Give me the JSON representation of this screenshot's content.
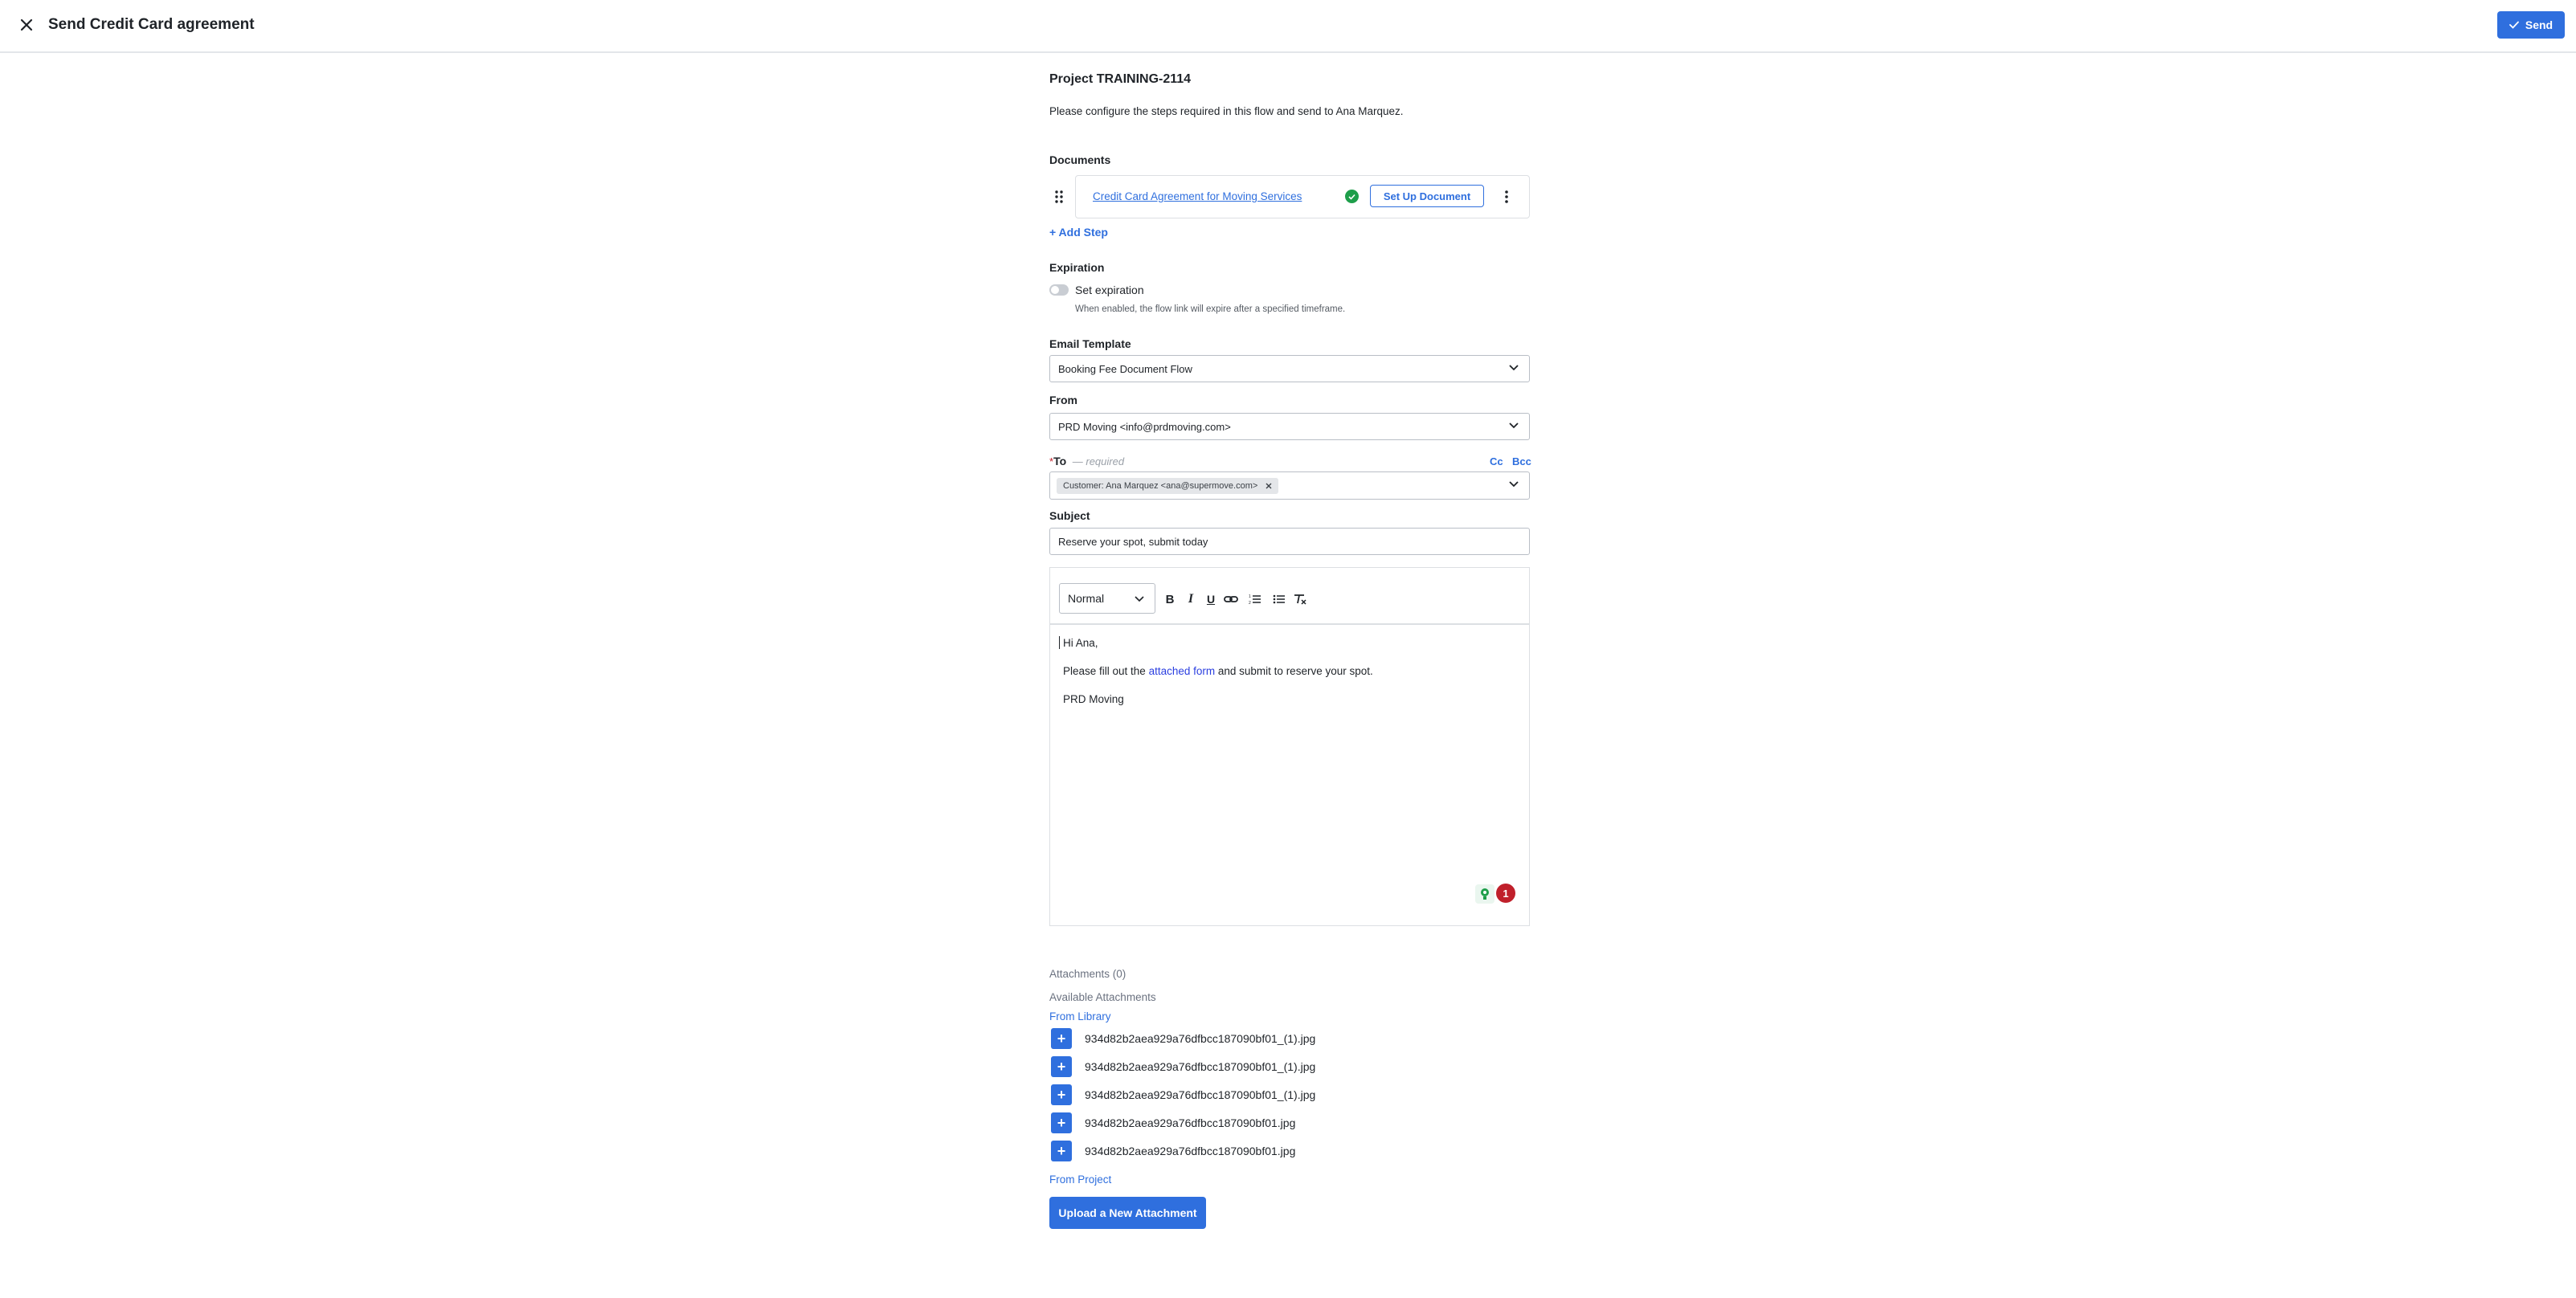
{
  "header": {
    "title": "Send Credit Card agreement",
    "send_label": "Send"
  },
  "project": {
    "title": "Project TRAINING-2114",
    "description": "Please configure the steps required in this flow and send to Ana Marquez."
  },
  "documents": {
    "heading": "Documents",
    "items": [
      {
        "name": "Credit Card Agreement for Moving Services",
        "status": "complete",
        "action_label": "Set Up Document"
      }
    ],
    "add_step_label": "+ Add Step"
  },
  "expiration": {
    "heading": "Expiration",
    "toggle_label": "Set expiration",
    "toggle_on": false,
    "help": "When enabled, the flow link will expire after a specified timeframe."
  },
  "email": {
    "template_label": "Email Template",
    "template_value": "Booking Fee Document Flow",
    "from_label": "From",
    "from_value": "PRD Moving <info@prdmoving.com>",
    "to_required_mark": "*",
    "to_label": "To",
    "to_hint": "— required",
    "cc_label": "Cc",
    "bcc_label": "Bcc",
    "to_chip": "Customer: Ana Marquez <ana@supermove.com>",
    "subject_label": "Subject",
    "subject_value": "Reserve your spot, submit today"
  },
  "editor": {
    "format_value": "Normal",
    "greeting": "Hi Ana,",
    "body_before": "Please fill out the",
    "body_link": "attached form",
    "body_after": "and submit to reserve your spot.",
    "signature": "PRD Moving",
    "grammar_count": "1"
  },
  "attachments": {
    "count_label": "Attachments (0)",
    "available_label": "Available Attachments",
    "from_library_label": "From Library",
    "library_files": [
      "934d82b2aea929a76dfbcc187090bf01_(1).jpg",
      "934d82b2aea929a76dfbcc187090bf01_(1).jpg",
      "934d82b2aea929a76dfbcc187090bf01_(1).jpg",
      "934d82b2aea929a76dfbcc187090bf01.jpg",
      "934d82b2aea929a76dfbcc187090bf01.jpg"
    ],
    "from_project_label": "From Project",
    "upload_label": "Upload a New Attachment"
  },
  "colors": {
    "accent": "#2f6fde",
    "success": "#1e9e4a",
    "badge_red": "#c0202b",
    "border": "#b9bec6"
  }
}
